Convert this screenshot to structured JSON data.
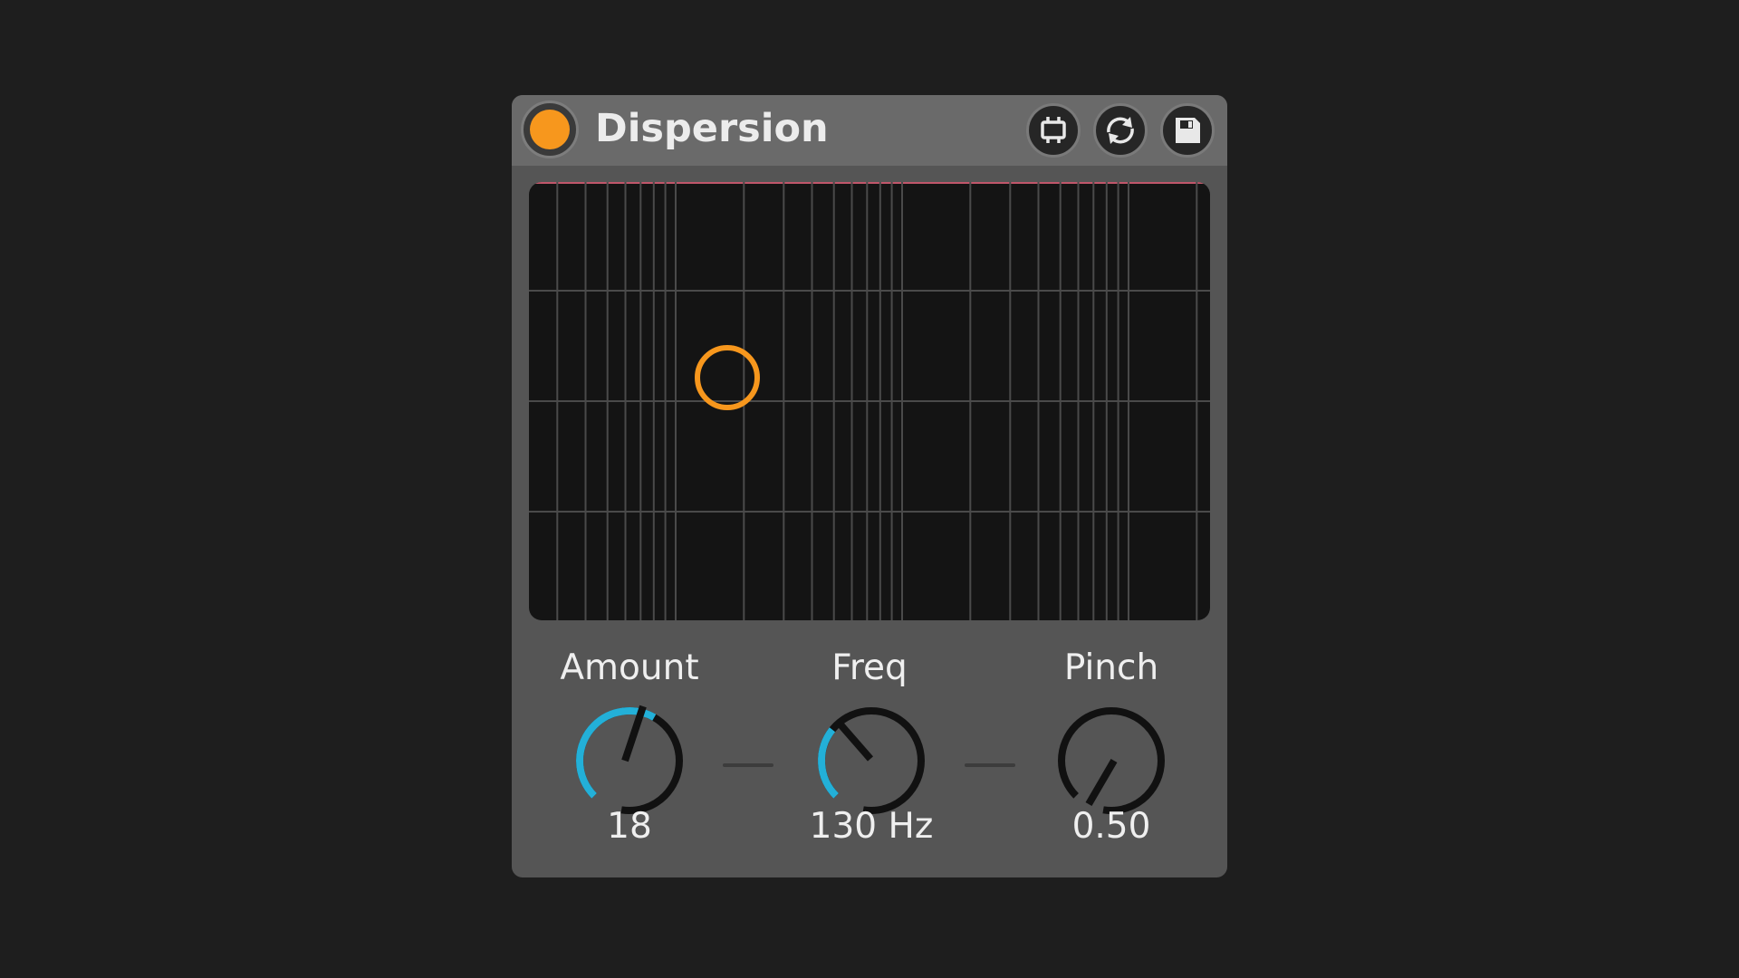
{
  "device": {
    "title": "Dispersion",
    "accent_color": "#f7971d",
    "knob_arc_color": "#23b0d8",
    "header_buttons": [
      {
        "name": "hot-swap-icon"
      },
      {
        "name": "refresh-icon"
      },
      {
        "name": "save-icon"
      }
    ]
  },
  "display": {
    "handle_color": "#f7971d"
  },
  "knobs": [
    {
      "label": "Amount",
      "value": "18"
    },
    {
      "label": "Freq",
      "value": "130 Hz"
    },
    {
      "label": "Pinch",
      "value": "0.50"
    }
  ]
}
